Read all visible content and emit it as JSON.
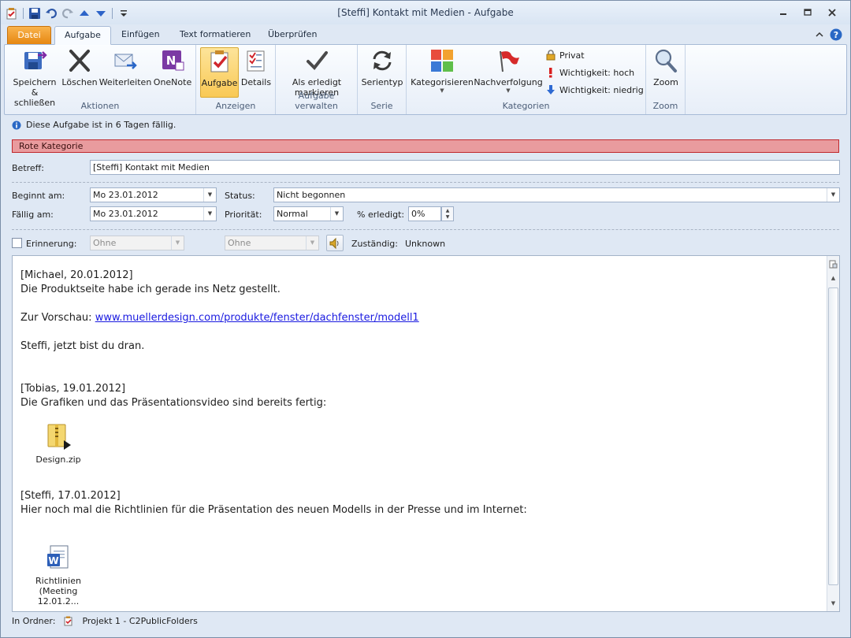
{
  "window": {
    "title": "[Steffi] Kontakt mit Medien  -  Aufgabe"
  },
  "tabs": {
    "file": "Datei",
    "task": "Aufgabe",
    "insert": "Einfügen",
    "format": "Text formatieren",
    "review": "Überprüfen"
  },
  "ribbon": {
    "actions": {
      "label": "Aktionen",
      "save_close": [
        "Speichern",
        "& schließen"
      ],
      "delete": "Löschen",
      "forward": "Weiterleiten",
      "onenote": "OneNote"
    },
    "show": {
      "label": "Anzeigen",
      "task": "Aufgabe",
      "details": "Details"
    },
    "manage": {
      "label": "Aufgabe verwalten",
      "mark_done": [
        "Als erledigt",
        "markieren"
      ]
    },
    "series": {
      "label": "Serie",
      "recurrence": "Serientyp"
    },
    "categories": {
      "label": "Kategorien",
      "categorize": "Kategorisieren",
      "follow_up": "Nachverfolgung",
      "private": "Privat",
      "high": "Wichtigkeit: hoch",
      "low": "Wichtigkeit: niedrig"
    },
    "zoom": {
      "label": "Zoom",
      "zoom": "Zoom"
    }
  },
  "info": {
    "due_message": "Diese Aufgabe ist in 6 Tagen fällig.",
    "category": "Rote Kategorie",
    "colors": {
      "category_fill": "#e99b9e",
      "category_border": "#c0282d"
    }
  },
  "form": {
    "subject_label": "Betreff:",
    "subject_value": "[Steffi] Kontakt mit Medien",
    "start_label": "Beginnt am:",
    "start_value": "Mo 23.01.2012",
    "due_label": "Fällig am:",
    "due_value": "Mo 23.01.2012",
    "status_label": "Status:",
    "status_value": "Nicht begonnen",
    "priority_label": "Priorität:",
    "priority_value": "Normal",
    "percent_label": "% erledigt:",
    "percent_value": "0%",
    "reminder_label": "Erinnerung:",
    "reminder_date": "Ohne",
    "reminder_time": "Ohne",
    "owner_label": "Zuständig:",
    "owner_value": "Unknown"
  },
  "body": {
    "p1_header": "[Michael, 20.01.2012]",
    "p1_line": "Die Produktseite habe ich gerade ins Netz gestellt.",
    "p1_preview_label": "Zur Vorschau: ",
    "p1_link": "www.muellerdesign.com/produkte/fenster/dachfenster/modell1",
    "p1_closing": "Steffi, jetzt bist du dran.",
    "p2_header": "[Tobias, 19.01.2012]",
    "p2_line": "Die Grafiken und das Präsentationsvideo sind bereits fertig:",
    "attach1": "Design.zip",
    "p3_header": "[Steffi, 17.01.2012]",
    "p3_line": "Hier noch mal die Richtlinien für die Präsentation des neuen Modells in der Presse und im Internet:",
    "attach2_line1": "Richtlinien",
    "attach2_line2": "(Meeting 12.01.2..."
  },
  "status": {
    "folder_label": "In Ordner:",
    "folder_value": "Projekt 1 - C2PublicFolders"
  }
}
